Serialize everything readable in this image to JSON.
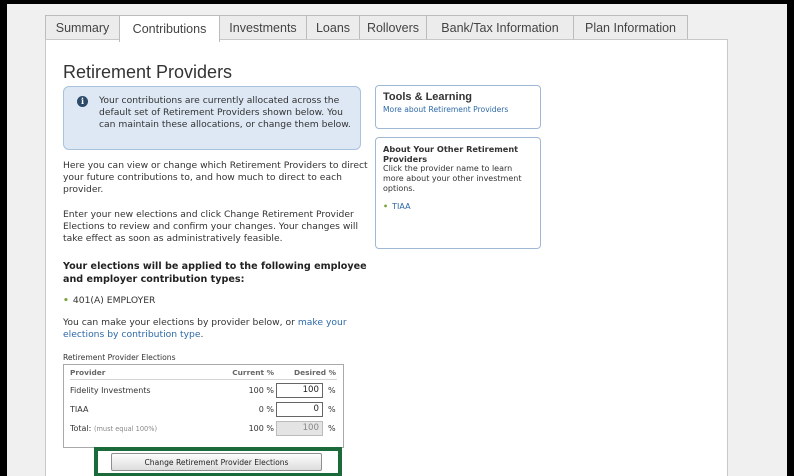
{
  "tabs": [
    {
      "label": "Summary",
      "active": false
    },
    {
      "label": "Contributions",
      "active": true
    },
    {
      "label": "Investments",
      "active": false
    },
    {
      "label": "Loans",
      "active": false
    },
    {
      "label": "Rollovers",
      "active": false
    },
    {
      "label": "Bank/Tax Information",
      "active": false
    },
    {
      "label": "Plan Information",
      "active": false
    }
  ],
  "page": {
    "title": "Retirement Providers",
    "info_message": "Your contributions are currently allocated across the default set of Retirement Providers shown below.  You can maintain these allocations, or change them below.",
    "paragraph_1": "Here you can view or change which Retirement Providers to direct your future contributions to, and how much to direct to each provider.",
    "paragraph_2": "Enter your new elections and click Change Retirement Provider Elections to review and confirm your changes. Your changes will take effect as soon as administratively feasible.",
    "applied_heading": "Your elections will be applied to the following employee and employer contribution types:",
    "contribution_type": "401(A) EMPLOYER",
    "provider_note_prefix": "You can make your elections by provider below, or ",
    "provider_note_link": "make your elections by contribution type",
    "provider_note_suffix": "."
  },
  "sidebar": {
    "tools_title": "Tools & Learning",
    "tools_link": "More about Retirement Providers",
    "other_title": "About Your Other Retirement Providers",
    "other_text": "Click the provider name to learn more about your other investment options.",
    "other_link": "TIAA"
  },
  "elections": {
    "caption": "Retirement Provider Elections",
    "headers": {
      "provider": "Provider",
      "current": "Current %",
      "desired": "Desired %"
    },
    "rows": [
      {
        "provider": "Fidelity Investments",
        "current": "100 %",
        "desired": "100",
        "unit": "%"
      },
      {
        "provider": "TIAA",
        "current": "0 %",
        "desired": "0",
        "unit": "%"
      }
    ],
    "total": {
      "label": "Total:",
      "note": "(must equal 100%)",
      "current": "100 %",
      "desired": "100",
      "unit": "%"
    }
  },
  "actions": {
    "change_button": "Change Retirement Provider Elections"
  }
}
